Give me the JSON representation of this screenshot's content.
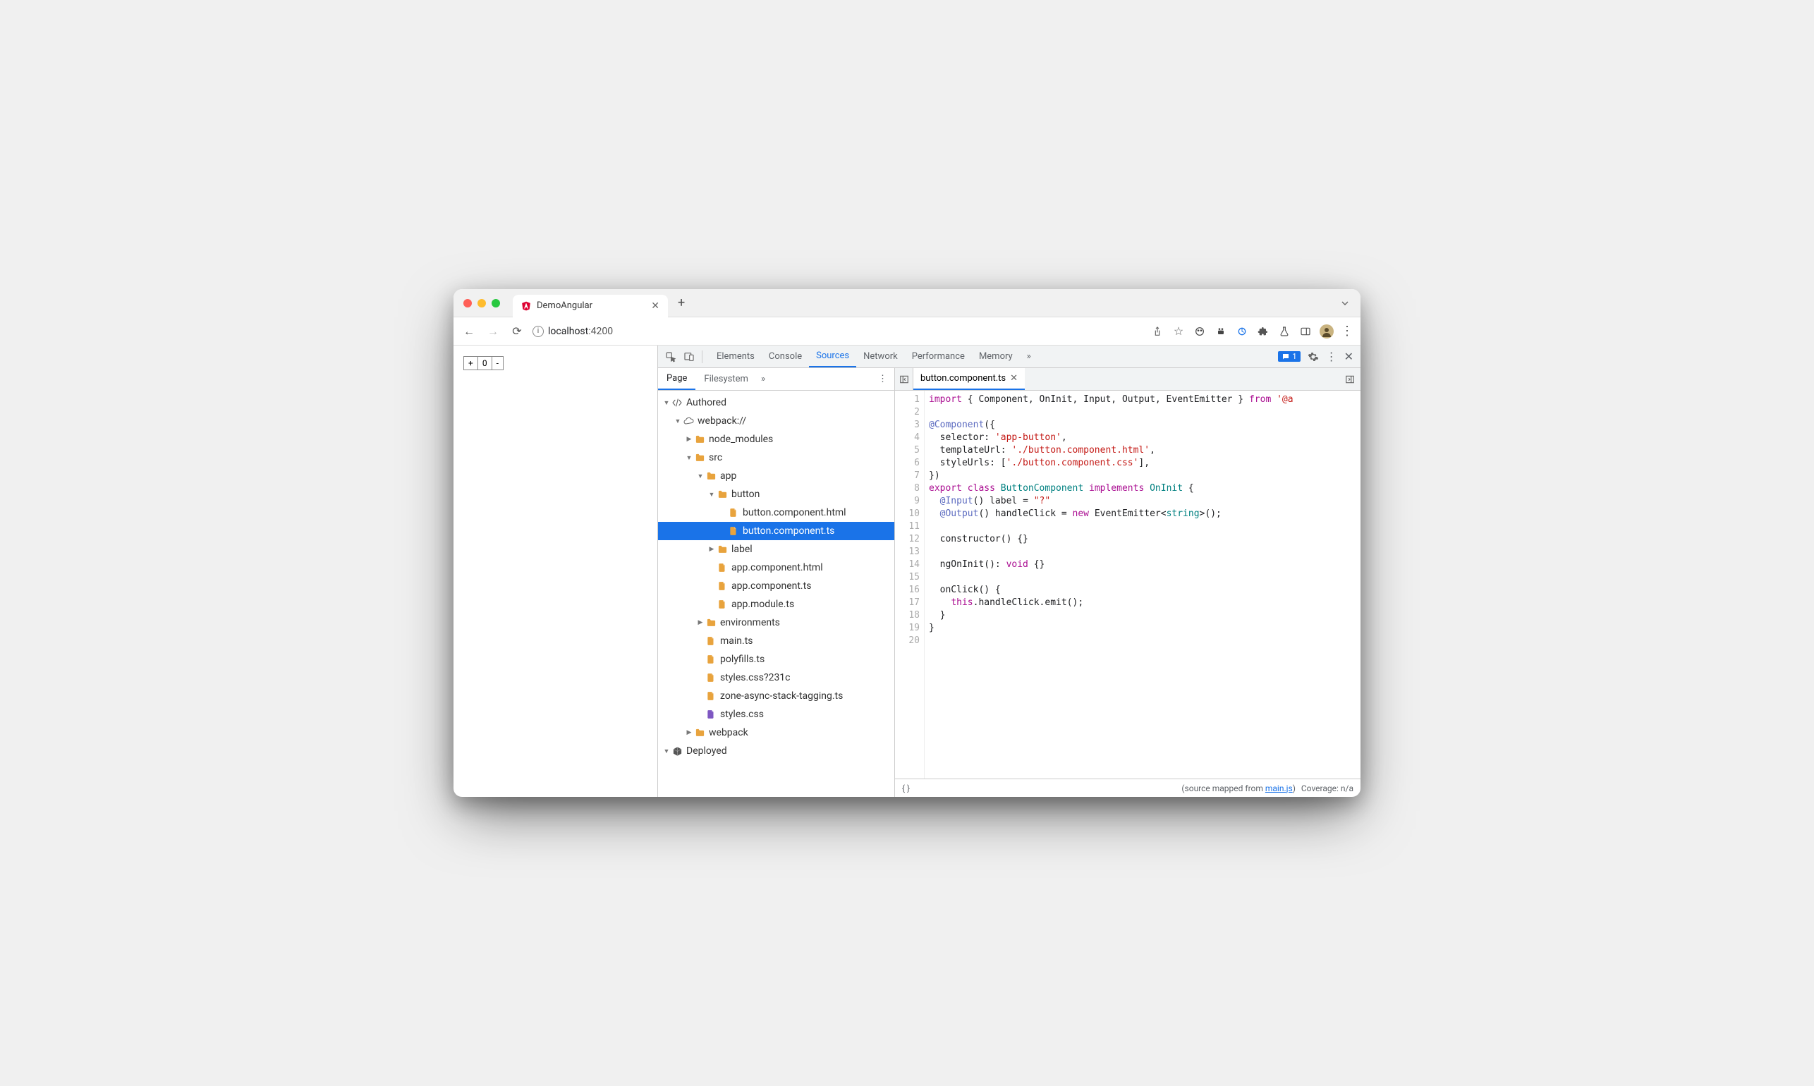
{
  "browser": {
    "tab_title": "DemoAngular",
    "url_host": "localhost",
    "url_port": ":4200"
  },
  "page": {
    "counter_plus": "+",
    "counter_value": "0",
    "counter_minus": "-"
  },
  "devtools": {
    "tabs": {
      "elements": "Elements",
      "console": "Console",
      "sources": "Sources",
      "network": "Network",
      "performance": "Performance",
      "memory": "Memory"
    },
    "issue_count": "1",
    "sidebar_tabs": {
      "page": "Page",
      "filesystem": "Filesystem"
    },
    "tree": {
      "authored": "Authored",
      "webpack": "webpack://",
      "node_modules": "node_modules",
      "src": "src",
      "app": "app",
      "button": "button",
      "button_html": "button.component.html",
      "button_ts": "button.component.ts",
      "label": "label",
      "app_html": "app.component.html",
      "app_ts": "app.component.ts",
      "app_module": "app.module.ts",
      "environments": "environments",
      "main_ts": "main.ts",
      "polyfills": "polyfills.ts",
      "styles_q": "styles.css?231c",
      "zone": "zone-async-stack-tagging.ts",
      "styles": "styles.css",
      "webpack_folder": "webpack",
      "deployed": "Deployed"
    },
    "open_file": "button.component.ts",
    "footer": {
      "prefix": "(source mapped from ",
      "link": "main.js",
      "suffix": ")",
      "coverage": "Coverage: n/a"
    },
    "code_lines": [
      [
        {
          "c": "kw",
          "t": "import"
        },
        {
          "c": "id",
          "t": " { "
        },
        {
          "c": "id",
          "t": "Component, OnInit, Input, Output, EventEmitter"
        },
        {
          "c": "id",
          "t": " } "
        },
        {
          "c": "kw",
          "t": "from"
        },
        {
          "c": "id",
          "t": " "
        },
        {
          "c": "str",
          "t": "'@a"
        }
      ],
      [
        {
          "c": "id",
          "t": ""
        }
      ],
      [
        {
          "c": "dec",
          "t": "@Component"
        },
        {
          "c": "id",
          "t": "({"
        }
      ],
      [
        {
          "c": "id",
          "t": "  selector: "
        },
        {
          "c": "str",
          "t": "'app-button'"
        },
        {
          "c": "id",
          "t": ","
        }
      ],
      [
        {
          "c": "id",
          "t": "  templateUrl: "
        },
        {
          "c": "str",
          "t": "'./button.component.html'"
        },
        {
          "c": "id",
          "t": ","
        }
      ],
      [
        {
          "c": "id",
          "t": "  styleUrls: ["
        },
        {
          "c": "str",
          "t": "'./button.component.css'"
        },
        {
          "c": "id",
          "t": "],"
        }
      ],
      [
        {
          "c": "id",
          "t": "})"
        }
      ],
      [
        {
          "c": "kw",
          "t": "export"
        },
        {
          "c": "id",
          "t": " "
        },
        {
          "c": "kw",
          "t": "class"
        },
        {
          "c": "id",
          "t": " "
        },
        {
          "c": "cls",
          "t": "ButtonComponent"
        },
        {
          "c": "id",
          "t": " "
        },
        {
          "c": "kw",
          "t": "implements"
        },
        {
          "c": "id",
          "t": " "
        },
        {
          "c": "type",
          "t": "OnInit"
        },
        {
          "c": "id",
          "t": " {"
        }
      ],
      [
        {
          "c": "id",
          "t": "  "
        },
        {
          "c": "dec",
          "t": "@Input"
        },
        {
          "c": "id",
          "t": "() label = "
        },
        {
          "c": "str",
          "t": "\"?\""
        }
      ],
      [
        {
          "c": "id",
          "t": "  "
        },
        {
          "c": "dec",
          "t": "@Output"
        },
        {
          "c": "id",
          "t": "() handleClick = "
        },
        {
          "c": "kw",
          "t": "new"
        },
        {
          "c": "id",
          "t": " EventEmitter<"
        },
        {
          "c": "type",
          "t": "string"
        },
        {
          "c": "id",
          "t": ">();"
        }
      ],
      [
        {
          "c": "id",
          "t": ""
        }
      ],
      [
        {
          "c": "id",
          "t": "  constructor() {}"
        }
      ],
      [
        {
          "c": "id",
          "t": ""
        }
      ],
      [
        {
          "c": "id",
          "t": "  ngOnInit(): "
        },
        {
          "c": "kw",
          "t": "void"
        },
        {
          "c": "id",
          "t": " {}"
        }
      ],
      [
        {
          "c": "id",
          "t": ""
        }
      ],
      [
        {
          "c": "id",
          "t": "  onClick() {"
        }
      ],
      [
        {
          "c": "id",
          "t": "    "
        },
        {
          "c": "this",
          "t": "this"
        },
        {
          "c": "id",
          "t": ".handleClick.emit();"
        }
      ],
      [
        {
          "c": "id",
          "t": "  }"
        }
      ],
      [
        {
          "c": "id",
          "t": "}"
        }
      ],
      [
        {
          "c": "id",
          "t": ""
        }
      ]
    ]
  }
}
